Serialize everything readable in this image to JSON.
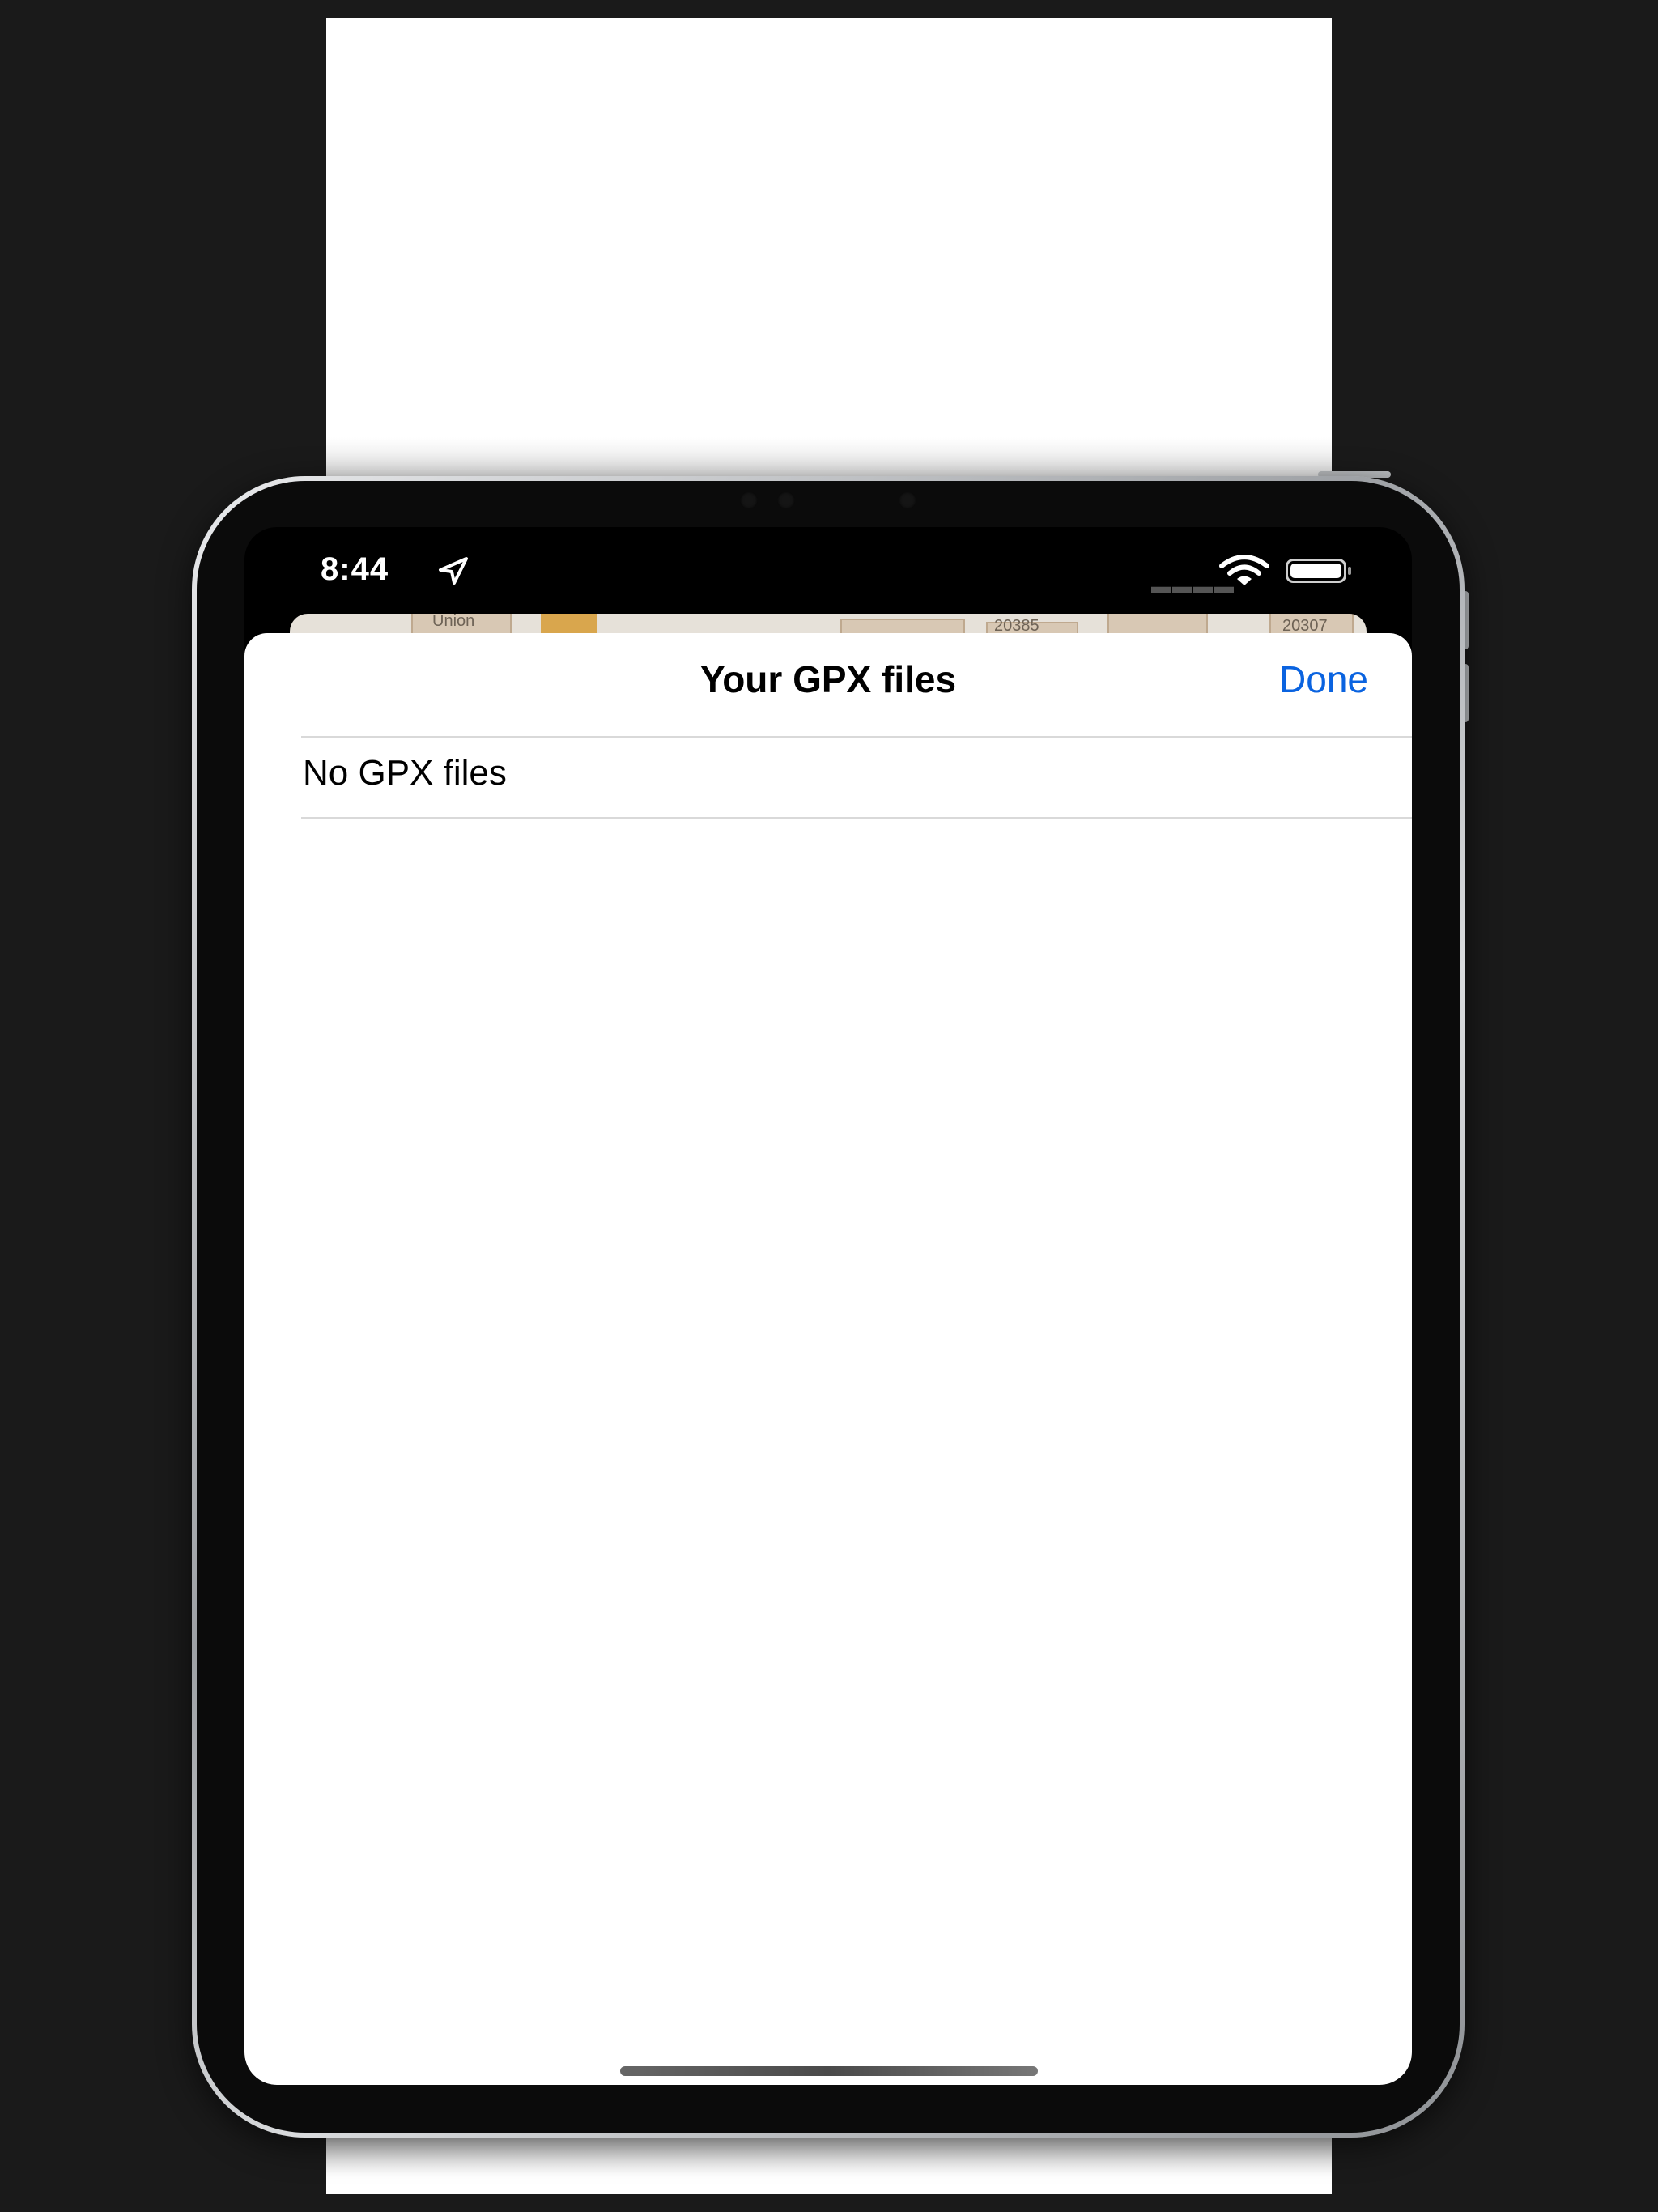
{
  "status_bar": {
    "time": "8:44",
    "location_icon": "location-arrow-icon",
    "signal_icon": "signal-dots-icon",
    "wifi_icon": "wifi-icon",
    "battery_icon": "battery-icon",
    "battery_level": 1.0
  },
  "map_preview": {
    "labels": [
      "Union",
      "20385",
      "20307"
    ]
  },
  "sheet": {
    "title": "Your GPX files",
    "done_label": "Done",
    "empty_message": "No GPX files"
  },
  "colors": {
    "accent": "#0a63e0",
    "background": "#1a1a1a",
    "sheet": "#ffffff"
  }
}
